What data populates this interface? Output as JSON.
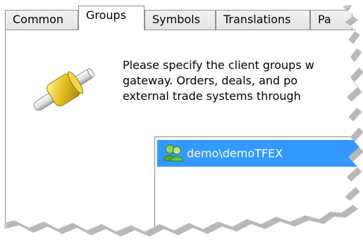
{
  "tabs": [
    {
      "label": "Common",
      "active": false
    },
    {
      "label": "Groups",
      "active": true
    },
    {
      "label": "Symbols",
      "active": false
    },
    {
      "label": "Translations",
      "active": false
    },
    {
      "label": "Pa",
      "active": false
    }
  ],
  "content": {
    "icon": "connector-icon",
    "description_lines": [
      "Please specify the client groups w",
      "gateway. Orders, deals, and po",
      "external trade systems through"
    ]
  },
  "group_list": {
    "items": [
      {
        "label": "demo\\demoTFEX",
        "icon": "users-group-icon",
        "selected": true
      }
    ]
  },
  "colors": {
    "selection": "#3399ff",
    "tab_border": "#8e8f8f",
    "icon_gold": "#e8c227",
    "icon_silver": "#e6e6e6",
    "group_icon_green": "#3fa02e"
  }
}
